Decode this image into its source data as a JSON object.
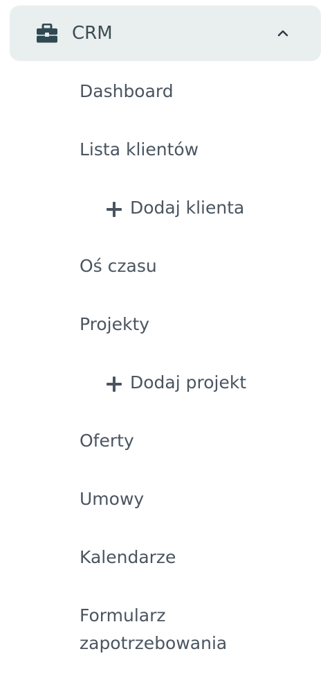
{
  "menu": {
    "group": {
      "label": "CRM",
      "icon": "briefcase-icon",
      "expanded_icon": "chevron-up-icon",
      "background": "#e9eeee",
      "icon_color": "#2f4a52"
    },
    "items": [
      {
        "label": "Dashboard"
      },
      {
        "label": "Lista klientów"
      },
      {
        "label": "Dodaj klienta",
        "icon": "plus-icon"
      },
      {
        "label": "Oś czasu"
      },
      {
        "label": "Projekty"
      },
      {
        "label": "Dodaj projekt",
        "icon": "plus-icon"
      },
      {
        "label": "Oferty"
      },
      {
        "label": "Umowy"
      },
      {
        "label": "Kalendarze"
      },
      {
        "label": "Formularz zapotrzebowania"
      }
    ]
  }
}
